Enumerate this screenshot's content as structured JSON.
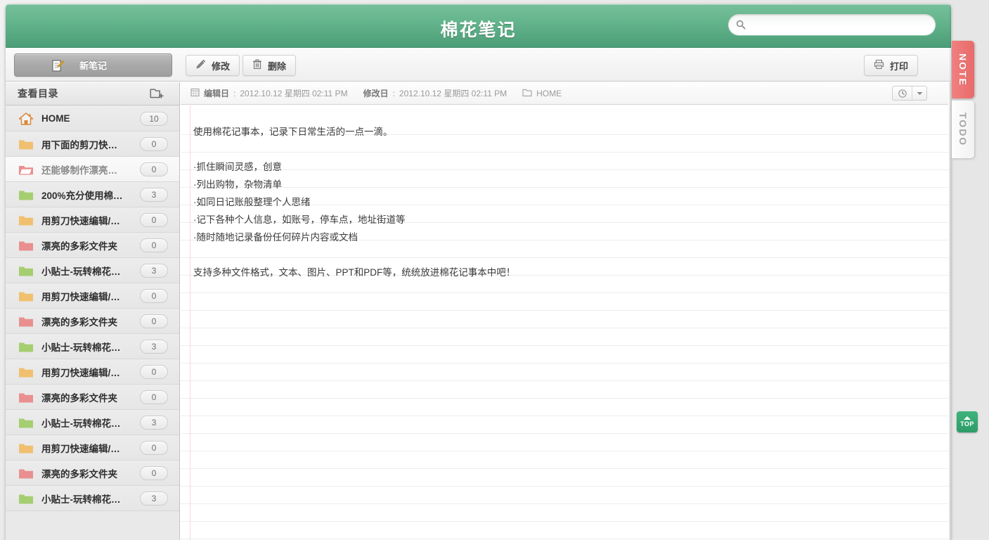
{
  "header": {
    "title": "棉花笔记",
    "search": {
      "value": "",
      "placeholder": "",
      "icon": "search-icon"
    },
    "brand_color": "#62b38b"
  },
  "toolbar": {
    "new_note_label": "新笔记",
    "new_note_icon": "note-pencil-icon",
    "edit_label": "修改",
    "edit_icon": "pencil-icon",
    "delete_label": "删除",
    "delete_icon": "trash-icon",
    "print_label": "打印",
    "print_icon": "printer-icon"
  },
  "sidebar": {
    "header_label": "查看目录",
    "add_folder_icon": "add-folder-icon",
    "items": [
      {
        "label": "HOME",
        "count": "10",
        "icon": "home-icon",
        "color": "#d98a3c",
        "selected": false
      },
      {
        "label": "用下面的剪刀快…",
        "count": "0",
        "icon": "folder-icon",
        "color": "#f0c070",
        "selected": false
      },
      {
        "label": "还能够制作漂亮…",
        "count": "0",
        "icon": "folder-open-icon",
        "color": "#e98f8f",
        "selected": true
      },
      {
        "label": "200%充分使用棉…",
        "count": "3",
        "icon": "folder-icon",
        "color": "#a5ce70",
        "selected": false
      },
      {
        "label": "用剪刀快速编辑/…",
        "count": "0",
        "icon": "folder-icon",
        "color": "#f0c070",
        "selected": false
      },
      {
        "label": "漂亮的多彩文件夹",
        "count": "0",
        "icon": "folder-icon",
        "color": "#e98f8f",
        "selected": false
      },
      {
        "label": "小贴士-玩转棉花…",
        "count": "3",
        "icon": "folder-icon",
        "color": "#a5ce70",
        "selected": false
      },
      {
        "label": "用剪刀快速编辑/…",
        "count": "0",
        "icon": "folder-icon",
        "color": "#f0c070",
        "selected": false
      },
      {
        "label": "漂亮的多彩文件夹",
        "count": "0",
        "icon": "folder-icon",
        "color": "#e98f8f",
        "selected": false
      },
      {
        "label": "小贴士-玩转棉花…",
        "count": "3",
        "icon": "folder-icon",
        "color": "#a5ce70",
        "selected": false
      },
      {
        "label": "用剪刀快速编辑/…",
        "count": "0",
        "icon": "folder-icon",
        "color": "#f0c070",
        "selected": false
      },
      {
        "label": "漂亮的多彩文件夹",
        "count": "0",
        "icon": "folder-icon",
        "color": "#e98f8f",
        "selected": false
      },
      {
        "label": "小贴士-玩转棉花…",
        "count": "3",
        "icon": "folder-icon",
        "color": "#a5ce70",
        "selected": false
      },
      {
        "label": "用剪刀快速编辑/…",
        "count": "0",
        "icon": "folder-icon",
        "color": "#f0c070",
        "selected": false
      },
      {
        "label": "漂亮的多彩文件夹",
        "count": "0",
        "icon": "folder-icon",
        "color": "#e98f8f",
        "selected": false
      },
      {
        "label": "小贴士-玩转棉花…",
        "count": "3",
        "icon": "folder-icon",
        "color": "#a5ce70",
        "selected": false
      }
    ]
  },
  "note": {
    "meta": {
      "created_key": "编辑日",
      "created_sep": ":",
      "created_value": "2012.10.12 星期四 02:11 PM",
      "modified_key": "修改日",
      "modified_sep": ":",
      "modified_value": "2012.10.12 星期四 02:11 PM",
      "folder_label": "HOME",
      "created_icon": "calendar-icon",
      "folder_icon": "folder-outline-icon",
      "clock_icon": "clock-icon",
      "dropdown_icon": "chevron-down-icon"
    },
    "lines": [
      "",
      "使用棉花记事本，记录下日常生活的一点一滴。",
      "",
      "·抓住瞬间灵感，创意",
      "·列出购物，杂物清单",
      "·如同日记账般整理个人思绪",
      "·记下各种个人信息，如账号，停车点，地址街道等",
      "·随时随地记录备份任何碎片内容或文档",
      "",
      "支持多种文件格式，文本、图片、PPT和PDF等，统统放进棉花记事本中吧！"
    ]
  },
  "side_tabs": [
    {
      "label": "NOTE",
      "active": true
    },
    {
      "label": "TODO",
      "active": false
    }
  ],
  "top_button": {
    "label": "TOP",
    "icon": "arrow-up-icon"
  }
}
